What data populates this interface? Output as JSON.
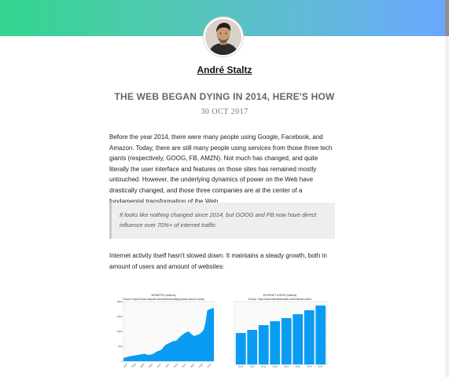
{
  "header": {
    "author_name": "André Staltz"
  },
  "post": {
    "title": "THE WEB BEGAN DYING IN 2014, HERE'S HOW",
    "date": "30 OCT 2017",
    "paragraph1": "Before the year 2014, there were many people using Google, Facebook, and Amazon. Today, there are still many people using services from those three tech giants (respectively, GOOG, FB, AMZN). Not much has changed, and quite literally the user interface and features on those sites has remained mostly untouched. However, the underlying dynamics of power on the Web have drastically changed, and those three companies are at the center of a fundamental transformation of the Web.",
    "quote": "It looks like nothing changed since 2014, but GOOG and FB now have direct influence over 70%+ of internet traffic.",
    "paragraph2": "Internet activity itself hasn't slowed down. It maintains a steady growth, both in amount of users and amount of websites:"
  },
  "colors": {
    "gradient_start": "#34d58f",
    "gradient_end": "#6aa7ff",
    "chart_blue": "#0a9cf2"
  },
  "chart_data": [
    {
      "type": "area",
      "title": "WEBSITES (millions)",
      "subtitle": "Source: https://news.netcraft.com/archives/category/web-server-survey",
      "y_ticks": [
        "0",
        "500",
        "1000",
        "1500",
        "2000"
      ],
      "ylim": [
        0,
        2000
      ],
      "x_ticks": [
        "2007",
        "2008",
        "2009",
        "2010",
        "2011",
        "2012",
        "2013",
        "2014",
        "2015",
        "2016",
        "2017"
      ],
      "x": [
        2007.0,
        2007.5,
        2008.0,
        2008.5,
        2009.0,
        2009.5,
        2010.0,
        2010.5,
        2011.0,
        2011.5,
        2012.0,
        2012.5,
        2013.0,
        2013.3,
        2013.6,
        2014.0,
        2014.4,
        2014.8,
        2015.0,
        2015.4,
        2015.8,
        2016.0,
        2016.3,
        2016.6,
        2016.8,
        2017.0,
        2017.3,
        2017.6,
        2017.8
      ],
      "values": [
        110,
        150,
        180,
        200,
        230,
        250,
        210,
        240,
        330,
        380,
        550,
        620,
        680,
        690,
        780,
        880,
        960,
        1000,
        940,
        850,
        880,
        900,
        960,
        1070,
        1300,
        1700,
        1750,
        1770,
        1790
      ]
    },
    {
      "type": "bar",
      "title": "INTERNET USERS (millions)",
      "subtitle": "Source: http://www.internetlivestats.com/internet-users/",
      "categories": [
        "2010",
        "2011",
        "2012",
        "2013",
        "2014",
        "2015",
        "2016",
        "2017"
      ],
      "values": [
        2000,
        2200,
        2500,
        2750,
        2950,
        3200,
        3450,
        3750
      ],
      "ylim": [
        0,
        4000
      ]
    }
  ]
}
